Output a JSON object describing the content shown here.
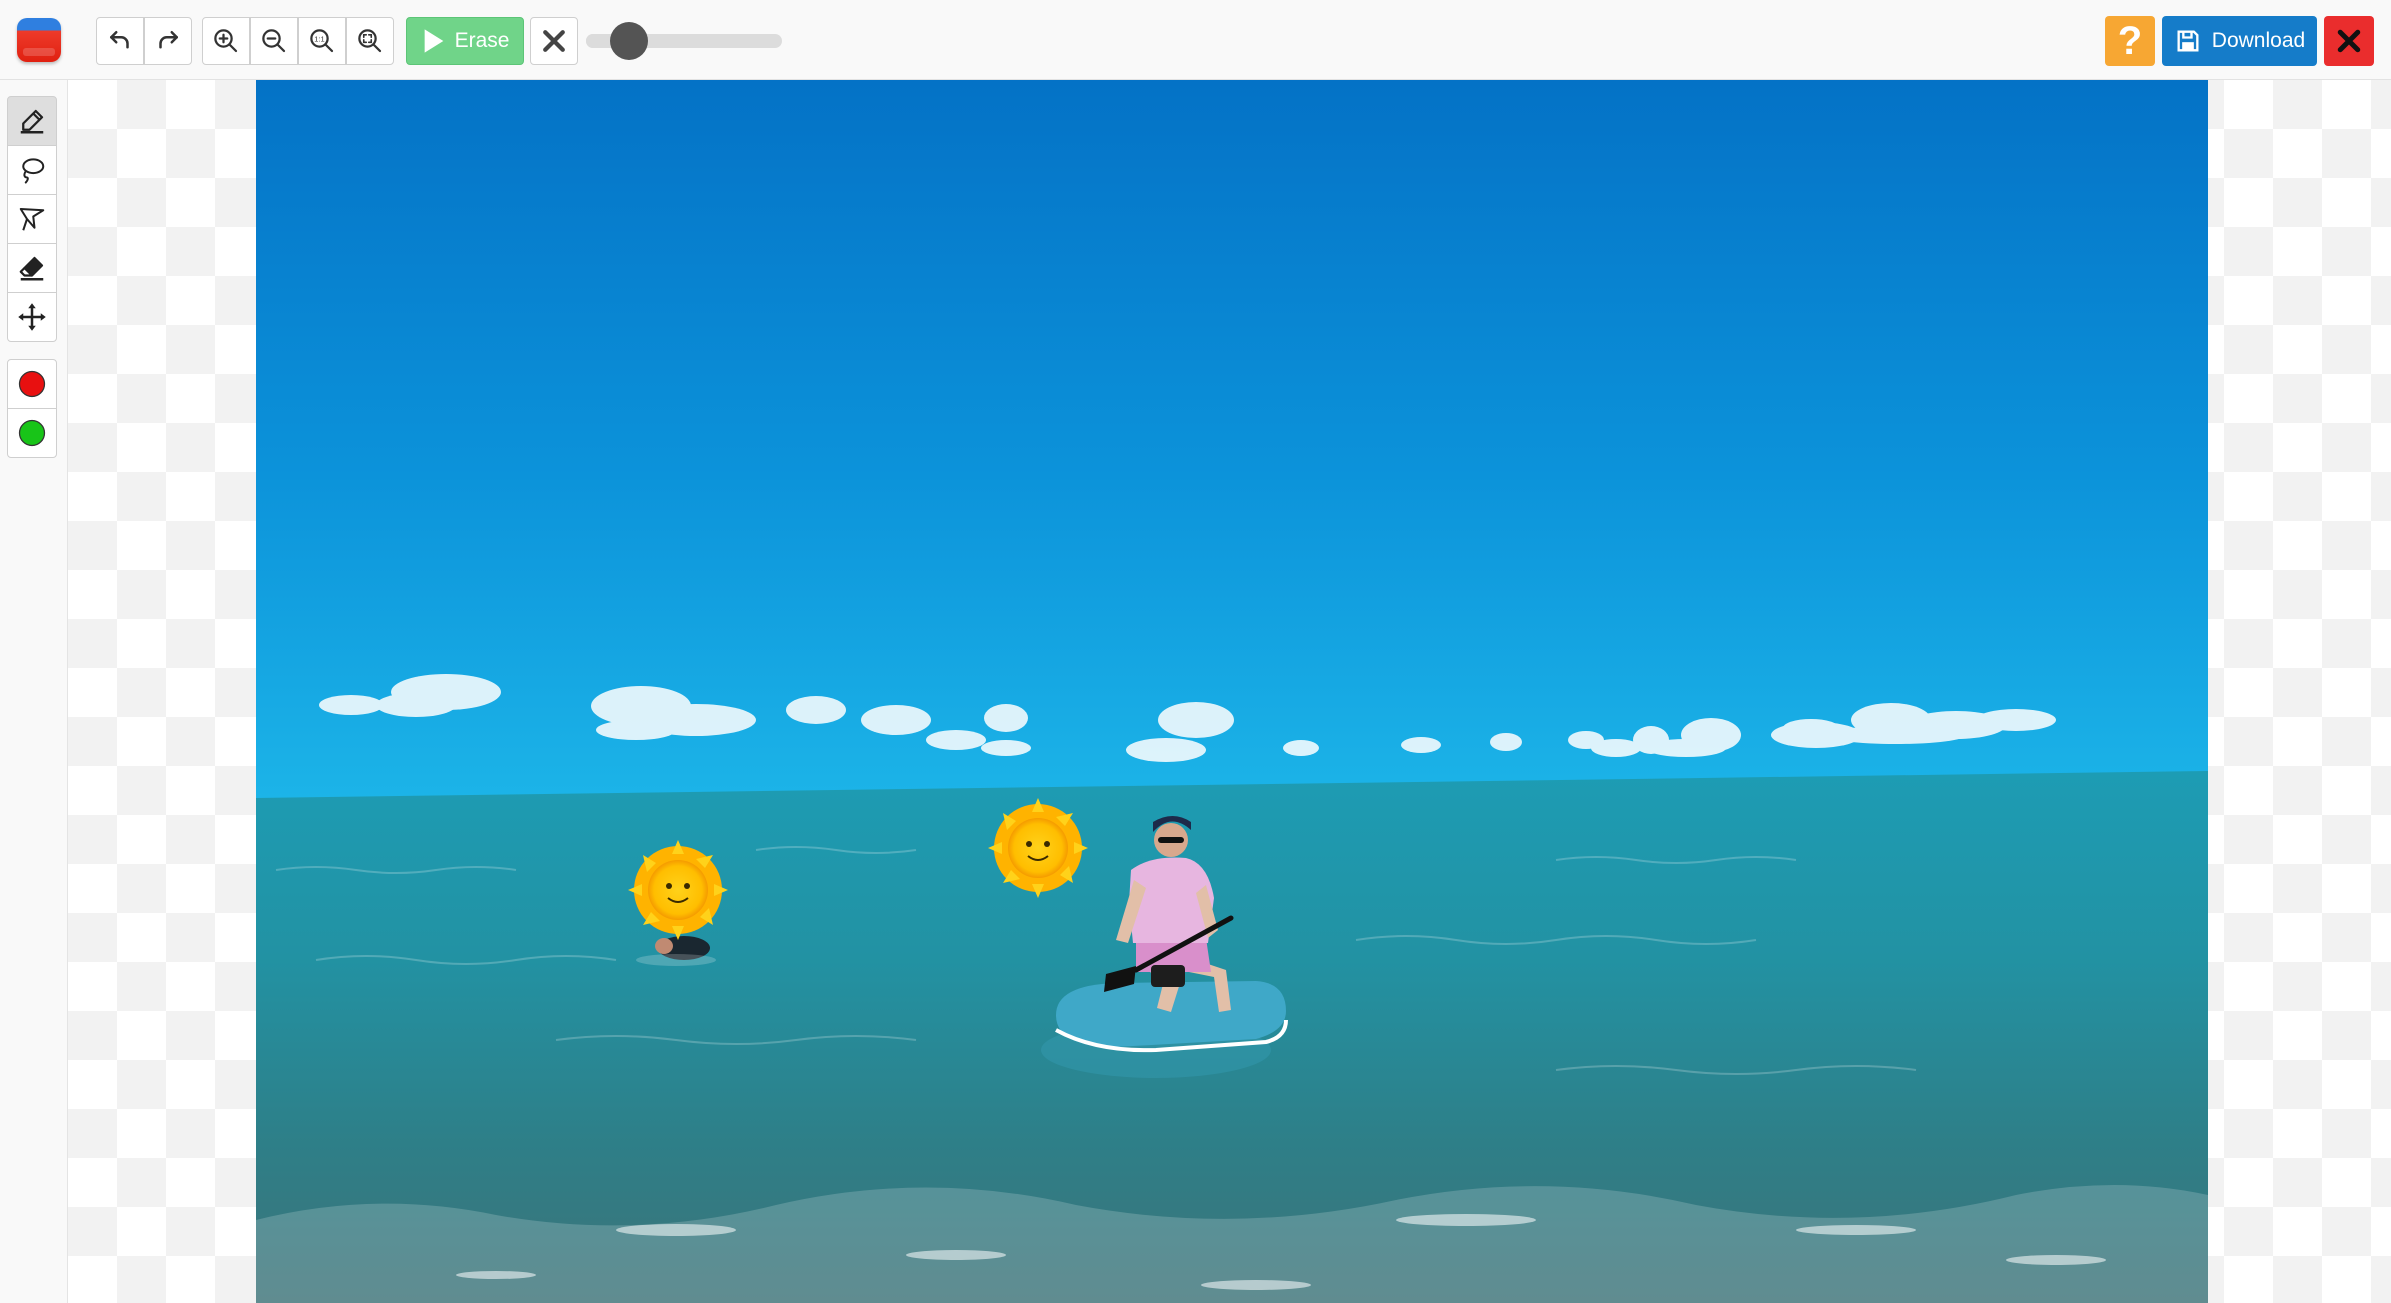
{
  "toolbar": {
    "logo_icon": "app-logo-icon",
    "undo_icon": "undo-icon",
    "redo_icon": "redo-icon",
    "zoom_in_icon": "zoom-in-icon",
    "zoom_out_icon": "zoom-out-icon",
    "zoom_actual_icon": "zoom-actual-size-icon",
    "zoom_fit_icon": "zoom-fit-icon",
    "erase_label": "Erase",
    "erase_icon": "play-icon",
    "clear_icon": "clear-x-icon",
    "brush_size_level": 0.22,
    "help_label": "?",
    "download_label": "Download",
    "download_icon": "save-icon",
    "close_icon": "close-icon"
  },
  "tools": [
    {
      "name": "brush-tool",
      "icon": "brush-icon",
      "active": true
    },
    {
      "name": "lasso-tool",
      "icon": "lasso-icon",
      "active": false
    },
    {
      "name": "polygon-lasso-tool",
      "icon": "polygon-lasso-icon",
      "active": false
    },
    {
      "name": "eraser-tool",
      "icon": "eraser-icon",
      "active": false
    },
    {
      "name": "move-tool",
      "icon": "move-icon",
      "active": false
    }
  ],
  "marker_colors": [
    {
      "name": "red-marker",
      "color": "#e81010"
    },
    {
      "name": "green-marker",
      "color": "#18c418"
    }
  ],
  "colors": {
    "erase_bg": "#70d489",
    "help_bg": "#f7a733",
    "download_bg": "#157cc9",
    "close_bg": "#ea2d2d",
    "sky_top": "#0476c9",
    "sky_bottom": "#18aee6",
    "sea": "#1f93a8"
  },
  "photo": {
    "description_icon": "beach-photo-canvas"
  }
}
